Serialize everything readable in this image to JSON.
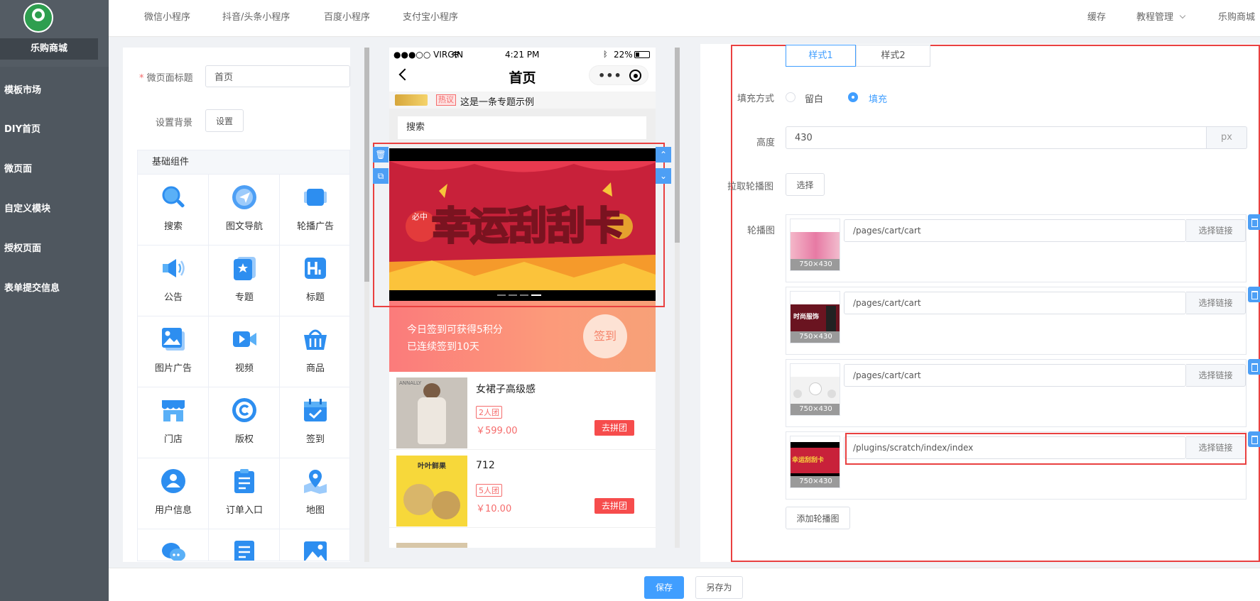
{
  "sidebar": {
    "brand": "乐购商城",
    "items": [
      {
        "label": "模板市场"
      },
      {
        "label": "DIY首页"
      },
      {
        "label": "微页面"
      },
      {
        "label": "自定义模块"
      },
      {
        "label": "授权页面"
      },
      {
        "label": "表单提交信息"
      }
    ]
  },
  "topbar": {
    "tabs": [
      "微信小程序",
      "抖音/头条小程序",
      "百度小程序",
      "支付宝小程序"
    ],
    "cache": "缓存",
    "tutorial": "教程管理",
    "shop": "乐购商城"
  },
  "left": {
    "title_label": "微页面标题",
    "title_value": "首页",
    "bg_label": "设置背景",
    "bg_button": "设置",
    "components_header": "基础组件",
    "components": [
      {
        "label": "搜索",
        "icon": "search-icon"
      },
      {
        "label": "图文导航",
        "icon": "navigation-icon"
      },
      {
        "label": "轮播广告",
        "icon": "carousel-icon"
      },
      {
        "label": "公告",
        "icon": "announcement-icon"
      },
      {
        "label": "专题",
        "icon": "topic-icon"
      },
      {
        "label": "标题",
        "icon": "heading-icon"
      },
      {
        "label": "图片广告",
        "icon": "image-ad-icon"
      },
      {
        "label": "视频",
        "icon": "video-icon"
      },
      {
        "label": "商品",
        "icon": "goods-icon"
      },
      {
        "label": "门店",
        "icon": "store-icon"
      },
      {
        "label": "版权",
        "icon": "copyright-icon"
      },
      {
        "label": "签到",
        "icon": "checkin-icon"
      },
      {
        "label": "用户信息",
        "icon": "user-info-icon"
      },
      {
        "label": "订单入口",
        "icon": "order-entry-icon"
      },
      {
        "label": "地图",
        "icon": "map-icon"
      }
    ]
  },
  "phone": {
    "status_carrier": "●●●○○ VIRGIN",
    "status_time": "4:21 PM",
    "status_battery": "22%",
    "nav_title": "首页",
    "notice_tag": "热议",
    "notice_text": "这是一条专题示例",
    "search_placeholder": "搜索",
    "banner_text": "幸运刮刮卡",
    "banner_badge": "必中",
    "signin_line1": "今日签到可获得5积分",
    "signin_line2": "已连续签到10天",
    "signin_button": "签到",
    "products": [
      {
        "title": "女裙子高级感",
        "tag": "2人团",
        "price": "￥599.00",
        "button": "去拼团",
        "img_brand": "ANNALLY"
      },
      {
        "title": "712",
        "tag": "5人团",
        "price": "￥10.00",
        "button": "去拼团",
        "img_brand": "叶叶鲜果"
      }
    ]
  },
  "right": {
    "style_tabs": [
      "样式1",
      "样式2"
    ],
    "fill_label": "填充方式",
    "fill_options": [
      "留白",
      "填充"
    ],
    "fill_selected": "填充",
    "height_label": "高度",
    "height_value": "430",
    "height_unit": "px",
    "pull_label": "拉取轮播图",
    "pull_button": "选择",
    "slides_label": "轮播图",
    "slides": [
      {
        "link": "/pages/cart/cart",
        "size": "750×430",
        "button": "选择链接"
      },
      {
        "link": "/pages/cart/cart",
        "size": "750×430",
        "button": "选择链接",
        "img_text": "时尚服饰"
      },
      {
        "link": "/pages/cart/cart",
        "size": "750×430",
        "button": "选择链接"
      },
      {
        "link": "/plugins/scratch/index/index",
        "size": "750×430",
        "button": "选择链接",
        "img_text": "幸运刮刮卡"
      }
    ],
    "add_button": "添加轮播图"
  },
  "footer": {
    "save": "保存",
    "save_as": "另存为"
  },
  "colors": {
    "sidebar": "#545c64",
    "accent": "#409eff",
    "highlight": "#e94040"
  }
}
